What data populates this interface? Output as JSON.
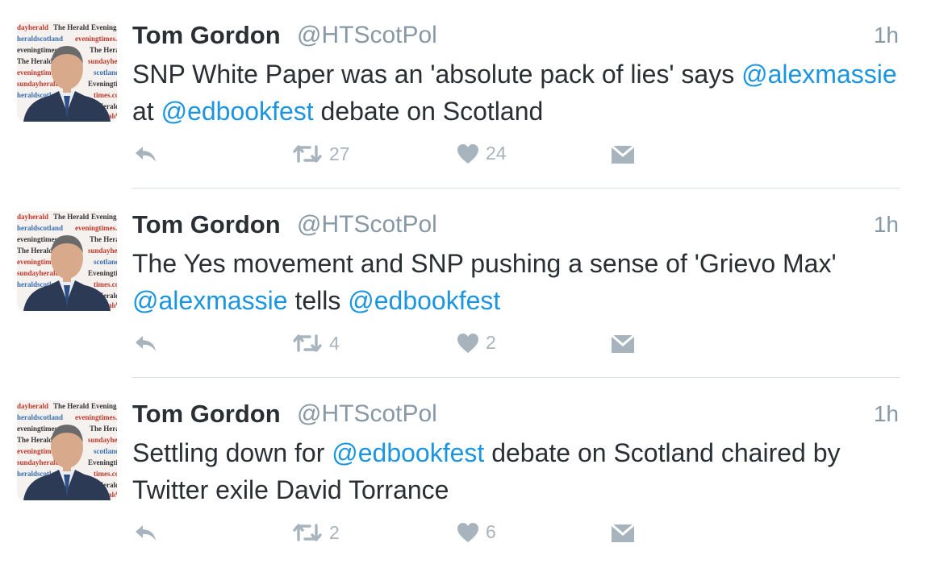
{
  "tweets": [
    {
      "author": "Tom Gordon",
      "handle": "@HTScotPol",
      "time": "1h",
      "text": [
        {
          "t": "SNP White Paper was an 'absolute pack of lies' says ",
          "m": false
        },
        {
          "t": "@alexmassie",
          "m": true
        },
        {
          "t": " at ",
          "m": false
        },
        {
          "t": "@edbookfest",
          "m": true
        },
        {
          "t": " debate on Scotland",
          "m": false
        }
      ],
      "retweets": "27",
      "likes": "24"
    },
    {
      "author": "Tom Gordon",
      "handle": "@HTScotPol",
      "time": "1h",
      "text": [
        {
          "t": "The Yes movement and SNP pushing a sense of 'Grievo Max' ",
          "m": false
        },
        {
          "t": "@alexmassie",
          "m": true
        },
        {
          "t": " tells ",
          "m": false
        },
        {
          "t": "@edbookfest",
          "m": true
        }
      ],
      "retweets": "4",
      "likes": "2"
    },
    {
      "author": "Tom Gordon",
      "handle": "@HTScotPol",
      "time": "1h",
      "text": [
        {
          "t": "Settling down for ",
          "m": false
        },
        {
          "t": "@edbookfest",
          "m": true
        },
        {
          "t": " debate on Scotland chaired by Twitter exile David Torrance",
          "m": false
        }
      ],
      "retweets": "2",
      "likes": "6"
    }
  ],
  "avatar_backdrop": [
    "dayherald",
    "The Herald",
    "Eveningtimes",
    "sundayherald",
    "heraldscotland.com",
    "eveningtimes.co.uk"
  ],
  "icons": {
    "reply": "reply-icon",
    "retweet": "retweet-icon",
    "like": "heart-icon",
    "dm": "envelope-icon"
  },
  "colors": {
    "name": "#292f33",
    "meta": "#8899a6",
    "mention": "#1b95e0",
    "action": "#a8b4bd",
    "divider": "#d8dee3"
  }
}
